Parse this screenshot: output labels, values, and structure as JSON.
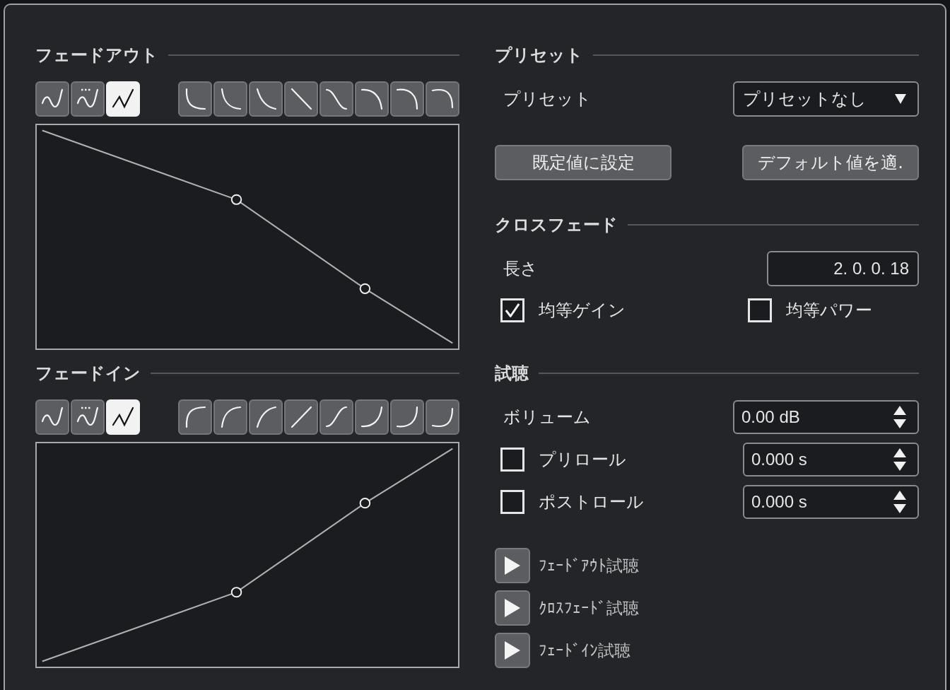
{
  "fades": [
    {
      "kind": "out",
      "title": "フェードアウト",
      "modes": [
        {
          "kind": "spline",
          "selected": false
        },
        {
          "kind": "damped",
          "selected": false
        },
        {
          "kind": "linear",
          "selected": true
        }
      ]
    },
    {
      "kind": "in",
      "title": "フェードイン",
      "modes": [
        {
          "kind": "spline",
          "selected": false
        },
        {
          "kind": "damped",
          "selected": false
        },
        {
          "kind": "linear",
          "selected": true
        }
      ]
    }
  ],
  "preset": {
    "title": "プリセット",
    "label": "プリセット",
    "value": "プリセットなし",
    "buttons": [
      "既定値に設定",
      "デフォルト値を適."
    ]
  },
  "crossfade": {
    "title": "クロスフェード",
    "length_label": "長さ",
    "length_value": "2. 0. 0. 18",
    "options": [
      {
        "label": "均等ゲイン",
        "checked": true
      },
      {
        "label": "均等パワー",
        "checked": false
      }
    ]
  },
  "preview": {
    "title": "試聴",
    "volume_label": "ボリューム",
    "volume_value": "0.00 dB",
    "rolls": [
      {
        "label": "プリロール",
        "checked": false,
        "value": "0.000 s"
      },
      {
        "label": "ポストロール",
        "checked": false,
        "value": "0.000 s"
      }
    ],
    "play_buttons": [
      "ﾌｪｰﾄﾞｱｳﾄ試聴",
      "ｸﾛｽﾌｪｰﾄﾞ試聴",
      "ﾌｪｰﾄﾞｲﾝ試聴"
    ]
  }
}
